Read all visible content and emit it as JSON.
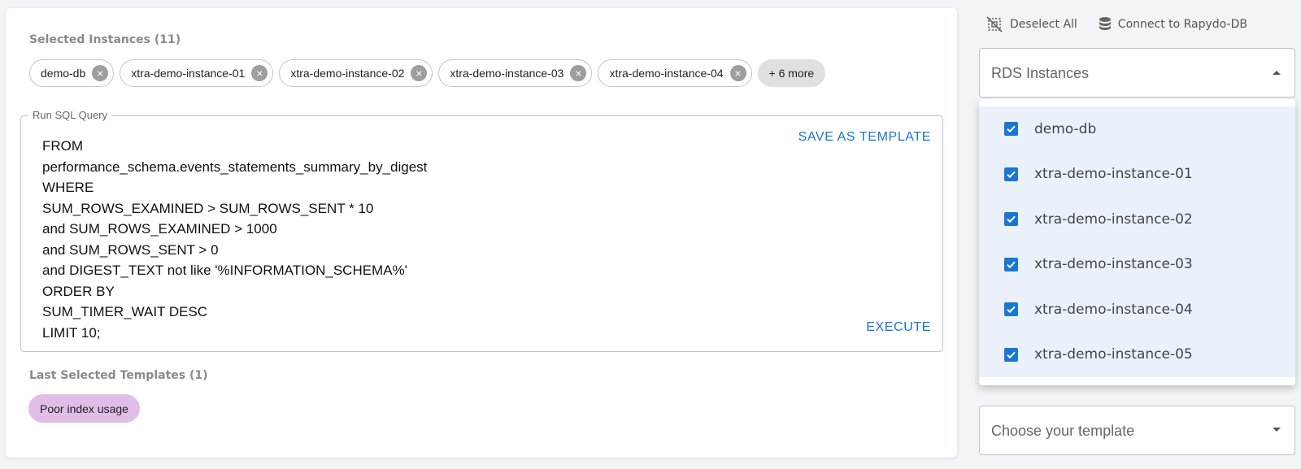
{
  "selected": {
    "label": "Selected Instances (11)",
    "chips": [
      "demo-db",
      "xtra-demo-instance-01",
      "xtra-demo-instance-02",
      "xtra-demo-instance-03",
      "xtra-demo-instance-04"
    ],
    "more": "+ 6 more"
  },
  "query": {
    "legend": "Run SQL Query",
    "text": "FROM\nperformance_schema.events_statements_summary_by_digest\nWHERE\nSUM_ROWS_EXAMINED > SUM_ROWS_SENT * 10\nand SUM_ROWS_EXAMINED > 1000\nand SUM_ROWS_SENT > 0\nand DIGEST_TEXT not like '%INFORMATION_SCHEMA%'\nORDER BY\nSUM_TIMER_WAIT DESC\nLIMIT 10;",
    "save_label": "SAVE AS TEMPLATE",
    "execute_label": "EXECUTE"
  },
  "templates": {
    "label": "Last Selected Templates (1)",
    "chips": [
      "Poor index usage"
    ]
  },
  "actions": {
    "deselect_label": "Deselect All",
    "connect_label": "Connect to Rapydo-DB"
  },
  "rds": {
    "label": "RDS Instances",
    "options": [
      "demo-db",
      "xtra-demo-instance-01",
      "xtra-demo-instance-02",
      "xtra-demo-instance-03",
      "xtra-demo-instance-04",
      "xtra-demo-instance-05"
    ]
  },
  "template_select": {
    "placeholder": "Choose your template"
  },
  "colors": {
    "accent": "#1976d2",
    "template_chip": "#e1bee7"
  },
  "icons": [
    "deselect-icon",
    "database-icon",
    "chip-cancel-icon",
    "arrow-up-icon",
    "arrow-down-icon",
    "checkbox-checked-icon"
  ]
}
